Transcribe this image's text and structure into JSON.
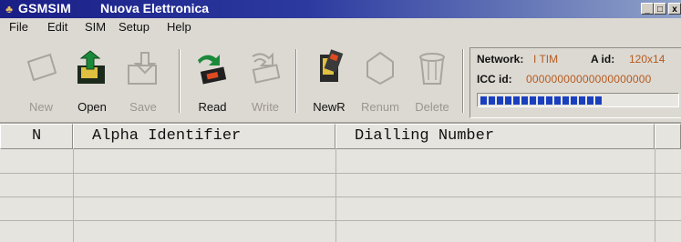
{
  "window": {
    "title": "GSMSIM",
    "subtitle": "Nuova Elettronica",
    "icon": "app-icon",
    "controls": [
      "_",
      "□",
      "x"
    ]
  },
  "menu": [
    "File",
    "Edit",
    "SIM",
    "Setup",
    "Help"
  ],
  "toolbar": {
    "buttons": [
      {
        "label": "New",
        "icon": "new-icon",
        "enabled": false
      },
      {
        "label": "Open",
        "icon": "open-icon",
        "enabled": true
      },
      {
        "label": "Save",
        "icon": "save-icon",
        "enabled": false
      },
      {
        "label": "Read",
        "icon": "read-icon",
        "enabled": true
      },
      {
        "label": "Write",
        "icon": "write-icon",
        "enabled": false
      },
      {
        "label": "NewR",
        "icon": "new-record-icon",
        "enabled": true
      },
      {
        "label": "Renum",
        "icon": "renumber-icon",
        "enabled": false
      },
      {
        "label": "Delete",
        "icon": "trash-icon",
        "enabled": false
      }
    ]
  },
  "status": {
    "network_label": "Network:",
    "network_value": "I TIM",
    "aid_label": "A id:",
    "aid_value": "120x14",
    "icc_label": "ICC id:",
    "icc_value": "00000000000000000000",
    "progress_fraction": 0.62
  },
  "table": {
    "columns": [
      "N",
      "Alpha Identifier",
      "Dialling Number"
    ],
    "rows": []
  },
  "colors": {
    "titlebar_start": "#1a1f86",
    "titlebar_end": "#8fa2c8",
    "value_text": "#b55a20",
    "progress_fill": "#1a3fbf"
  }
}
